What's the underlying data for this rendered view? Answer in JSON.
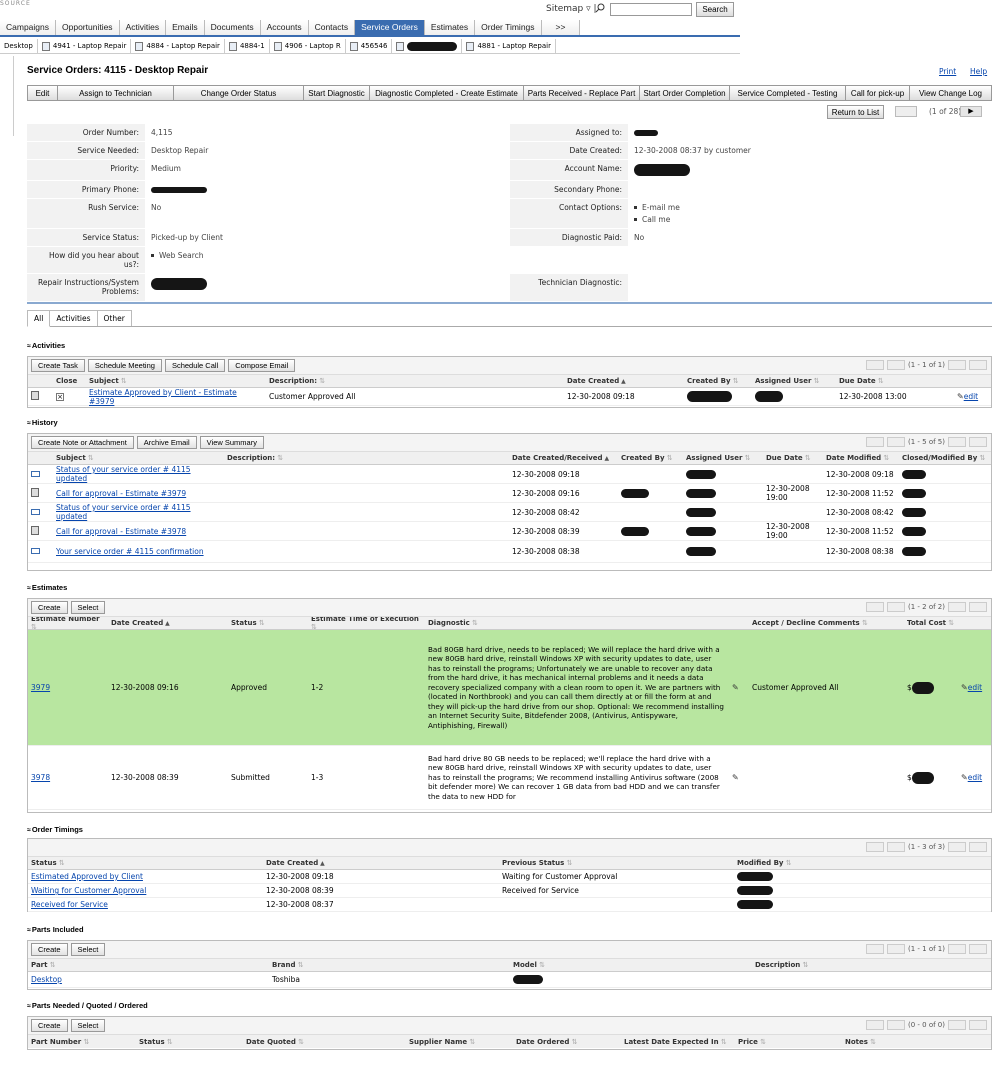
{
  "header": {
    "logo": "SOURCE",
    "sitemap": "Sitemap ▿ |",
    "search_button": "Search",
    "search_value": ""
  },
  "module_tabs": [
    "Campaigns",
    "Opportunities",
    "Activities",
    "Emails",
    "Documents",
    "Accounts",
    "Contacts",
    "Service Orders",
    "Estimates",
    "Order Timings",
    ">>"
  ],
  "recent": [
    "Desktop",
    "4941 - Laptop Repair",
    "4884 - Laptop Repair",
    "4884-1",
    "4906 - Laptop R",
    "456546",
    "",
    "4881 - Laptop Repair"
  ],
  "page": {
    "title": "Service Orders: 4115 - Desktop Repair",
    "print": "Print",
    "help": "Help",
    "return": "Return to List",
    "pager": "(1 of 28)"
  },
  "actions": [
    "Edit",
    "Assign to Technician",
    "Change Order Status",
    "Start Diagnostic",
    "Diagnostic Completed - Create Estimate",
    "Parts Received - Replace Part",
    "Start Order Completion",
    "Service Completed - Testing",
    "Call for pick-up",
    "View Change Log"
  ],
  "detail": {
    "order_number_label": "Order Number:",
    "order_number": "4,115",
    "assigned_label": "Assigned to:",
    "service_needed_label": "Service Needed:",
    "service_needed": "Desktop Repair",
    "date_created_label": "Date Created:",
    "date_created": "12-30-2008 08:37 by customer",
    "priority_label": "Priority:",
    "priority": "Medium",
    "account_label": "Account Name:",
    "primary_phone_label": "Primary Phone:",
    "secondary_phone_label": "Secondary Phone:",
    "rush_label": "Rush Service:",
    "rush": "No",
    "contact_label": "Contact Options:",
    "contact_opts": [
      "E-mail me",
      "Call me"
    ],
    "status_label": "Service Status:",
    "status": "Picked-up by Client",
    "diag_paid_label": "Diagnostic Paid:",
    "diag_paid": "No",
    "hear_label": "How did you hear about us?:",
    "hear": "Web Search",
    "repair_label": "Repair Instructions/System Problems:",
    "tech_diag_label": "Technician Diagnostic:"
  },
  "subtabs": [
    "All",
    "Activities",
    "Other"
  ],
  "activities": {
    "title": "Activities",
    "buttons": [
      "Create Task",
      "Schedule Meeting",
      "Schedule Call",
      "Compose Email"
    ],
    "pager": "(1 - 1 of 1)",
    "headers": [
      "Close",
      "Subject",
      "Description:",
      "Date Created",
      "Created By",
      "Assigned User",
      "Due Date"
    ],
    "rows": [
      {
        "subject": "Estimate Approved by Client - Estimate #3979",
        "description": "Customer Approved All",
        "created": "12-30-2008 09:18",
        "due": "12-30-2008 13:00",
        "edit": "edit"
      }
    ]
  },
  "history": {
    "title": "History",
    "buttons": [
      "Create Note or Attachment",
      "Archive Email",
      "View Summary"
    ],
    "pager": "(1 - 5 of 5)",
    "headers": [
      "Subject",
      "Description:",
      "Date Created/Received",
      "Created By",
      "Assigned User",
      "Due Date",
      "Date Modified",
      "Closed/Modified By"
    ],
    "rows": [
      {
        "subject": "Status of your service order # 4115 updated",
        "created": "12-30-2008 09:18",
        "due": "",
        "modified": "12-30-2008 09:18"
      },
      {
        "subject": "Call for approval - Estimate #3979",
        "created": "12-30-2008 09:16",
        "due": "12-30-2008 19:00",
        "modified": "12-30-2008 11:52"
      },
      {
        "subject": "Status of your service order # 4115 updated",
        "created": "12-30-2008 08:42",
        "due": "",
        "modified": "12-30-2008 08:42"
      },
      {
        "subject": "Call for approval - Estimate #3978",
        "created": "12-30-2008 08:39",
        "due": "12-30-2008 19:00",
        "modified": "12-30-2008 11:52"
      },
      {
        "subject": "Your service order # 4115 confirmation",
        "created": "12-30-2008 08:38",
        "due": "",
        "modified": "12-30-2008 08:38"
      }
    ]
  },
  "estimates": {
    "title": "Estimates",
    "buttons": [
      "Create",
      "Select"
    ],
    "pager": "(1 - 2 of 2)",
    "headers": [
      "Estimate Number",
      "Date Created",
      "Status",
      "Estimate Time of Execution",
      "Diagnostic",
      "Accept / Decline Comments",
      "Total Cost"
    ],
    "rows": [
      {
        "number": "3979",
        "created": "12-30-2008 09:16",
        "status": "Approved",
        "time": "1-2",
        "diagnostic": "Bad 80GB hard drive, needs to be replaced; We will replace the hard drive with a new 80GB hard drive, reinstall Windows XP with security updates to date, user has to reinstall the programs; Unfortunately we are unable to recover any data from the hard drive, it has mechanical internal problems and it needs a data recovery specialized company with a clean room to open it. We are partners with (located in Northbrook) and you can call them directly at or fill the form at and they will pick-up the hard drive from our shop. Optional: We recommend installing an Internet Security Suite, Bitdefender 2008, (Antivirus, Antispyware, Antiphishing, Firewall)",
        "comment": "Customer Approved All",
        "cost": "$",
        "edit": "edit"
      },
      {
        "number": "3978",
        "created": "12-30-2008 08:39",
        "status": "Submitted",
        "time": "1-3",
        "diagnostic": "Bad hard drive 80 GB needs to be replaced; we'll replace the hard drive with a new 80GB hard drive, reinstall Windows XP with security updates to date, user has to reinstall the programs; We recommend installing Antivirus software (2008 bit defender more) We can recover 1 GB data from bad HDD and we can transfer the data to new HDD for",
        "comment": "",
        "cost": "$",
        "edit": "edit"
      }
    ]
  },
  "timings": {
    "title": "Order Timings",
    "pager": "(1 - 3 of 3)",
    "headers": [
      "Status",
      "Date Created",
      "Previous Status",
      "Modified By"
    ],
    "rows": [
      {
        "status": "Estimated Approved by Client",
        "created": "12-30-2008 09:18",
        "prev": "Waiting for Customer Approval"
      },
      {
        "status": "Waiting for Customer Approval",
        "created": "12-30-2008 08:39",
        "prev": "Received for Service"
      },
      {
        "status": "Received for Service",
        "created": "12-30-2008 08:37",
        "prev": ""
      }
    ]
  },
  "parts": {
    "title": "Parts Included",
    "buttons": [
      "Create",
      "Select"
    ],
    "pager": "(1 - 1 of 1)",
    "headers": [
      "Part",
      "Brand",
      "Model",
      "Description"
    ],
    "rows": [
      {
        "part": "Desktop",
        "brand": "Toshiba"
      }
    ]
  },
  "needed": {
    "title": "Parts Needed / Quoted / Ordered",
    "buttons": [
      "Create",
      "Select"
    ],
    "pager": "(0 - 0 of 0)",
    "headers": [
      "Part Number",
      "Status",
      "Date Quoted",
      "Supplier Name",
      "Date Ordered",
      "Latest Date Expected In",
      "Price",
      "Notes"
    ]
  },
  "colors": {
    "accent": "#3a6cb0",
    "approved_row": "#b8e6a0"
  }
}
